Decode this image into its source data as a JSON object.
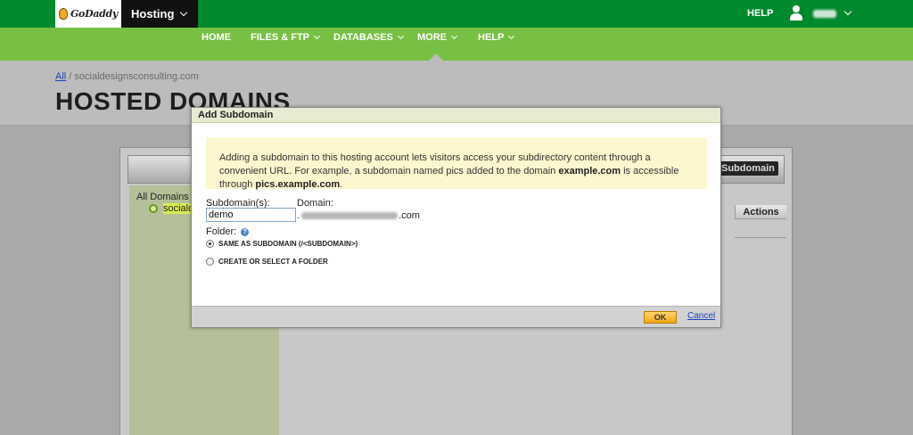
{
  "topbar": {
    "logo_text": "GoDaddy",
    "hosting_label": "Hosting",
    "help_label": "HELP"
  },
  "nav": {
    "items": [
      {
        "label": "HOME"
      },
      {
        "label": "FILES & FTP"
      },
      {
        "label": "DATABASES"
      },
      {
        "label": "MORE"
      },
      {
        "label": "HELP"
      }
    ]
  },
  "header": {
    "breadcrumb_all": "All",
    "breadcrumb_sep": "/",
    "breadcrumb_domain": "socialdesignsconsulting.com",
    "title": "HOSTED DOMAINS"
  },
  "background": {
    "add_subdomain_button": "Subdomain",
    "tree_root": "All Domains",
    "tree_node": "sociald",
    "actions_column": "Actions"
  },
  "modal": {
    "title": "Add Subdomain",
    "info_text_1": "Adding a subdomain to this hosting account lets visitors access your subdirectory content through a convenient URL. For example, a subdomain named pics added to the domain ",
    "info_domain": "example.com",
    "info_text_2": " is accessible through ",
    "info_sub": "pics.example.com",
    "info_end": ".",
    "subdomain_label": "Subdomain(s):",
    "subdomain_value": "demo",
    "domain_label": "Domain:",
    "domain_prefix": ".",
    "domain_suffix": ".com",
    "folder_label": "Folder:",
    "help_icon_text": "?",
    "option_same": "SAME AS SUBDOMAIN (/<SUBDOMAIN>)",
    "option_create": "CREATE OR SELECT A FOLDER",
    "ok_label": "OK",
    "cancel_label": "Cancel"
  },
  "colors": {
    "top_green": "#008a2e",
    "nav_green": "#77c043",
    "ok_orange": "#f2a716"
  }
}
